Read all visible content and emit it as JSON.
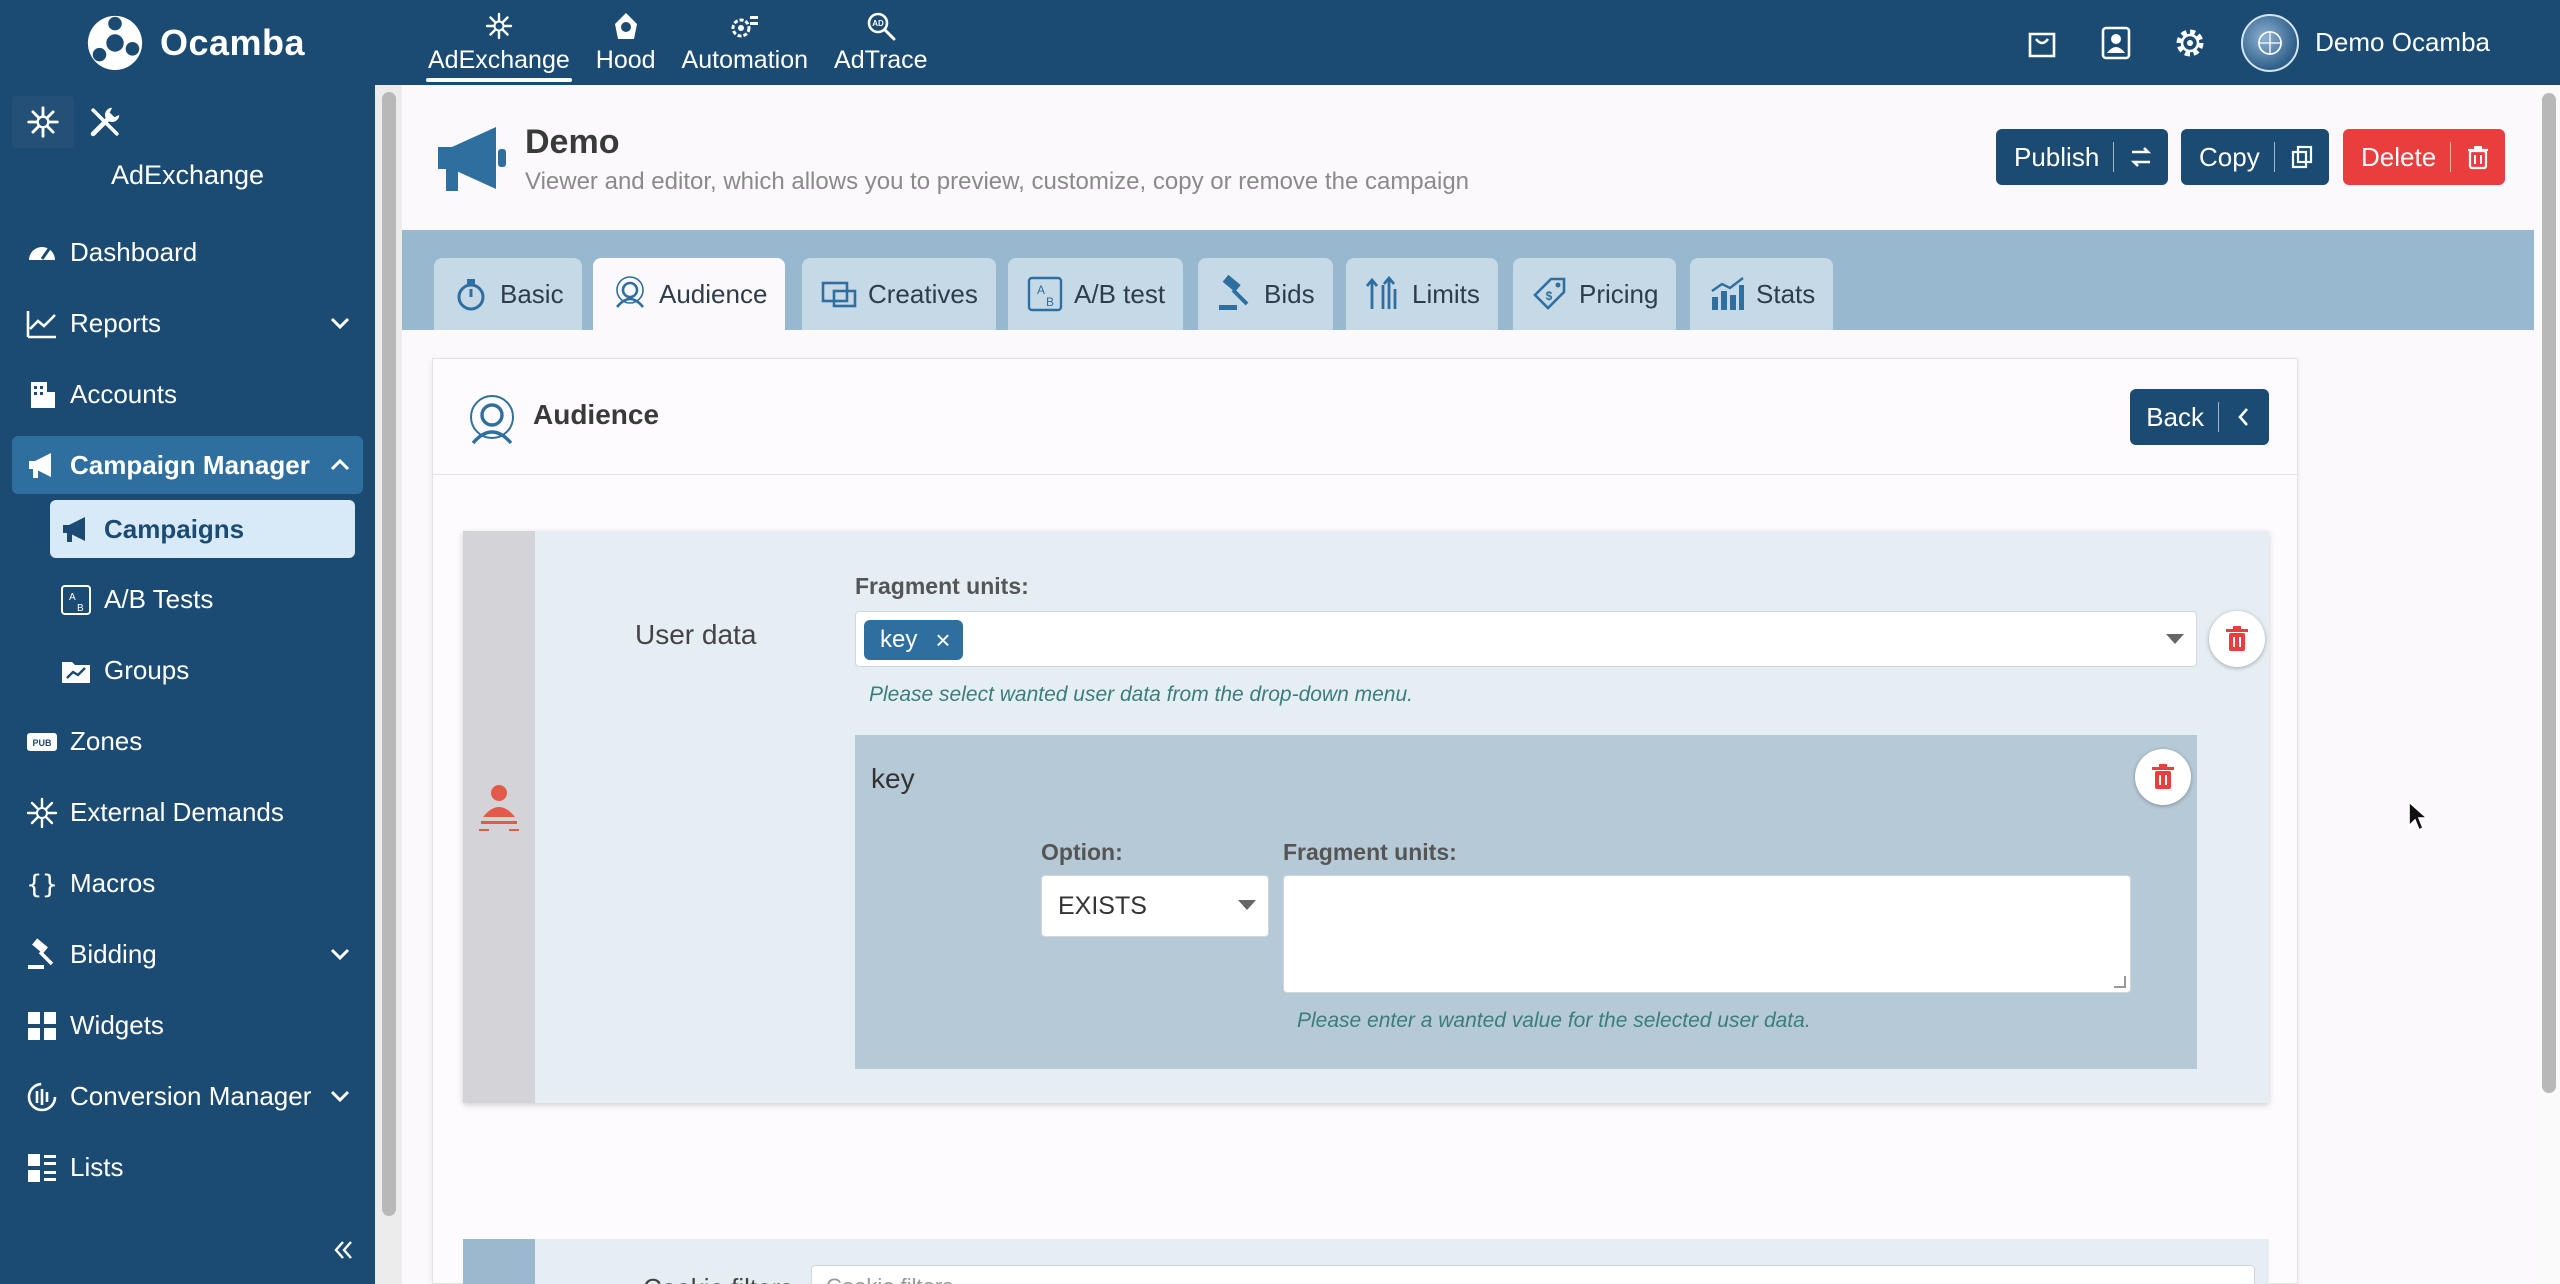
{
  "app": {
    "brand": "Ocamba",
    "topnav": [
      {
        "label": "AdExchange",
        "icon": "adexchange-icon",
        "active": true
      },
      {
        "label": "Hood",
        "icon": "hood-icon"
      },
      {
        "label": "Automation",
        "icon": "automation-icon"
      },
      {
        "label": "AdTrace",
        "icon": "adtrace-icon"
      }
    ],
    "user_name": "Demo Ocamba"
  },
  "sidebar": {
    "section": "AdExchange",
    "items": [
      {
        "label": "Dashboard",
        "icon": "dashboard-icon"
      },
      {
        "label": "Reports",
        "icon": "reports-icon"
      },
      {
        "label": "Accounts",
        "icon": "accounts-icon"
      },
      {
        "label": "Campaign Manager",
        "icon": "megaphone-icon"
      },
      {
        "label": "Campaigns",
        "icon": "megaphone-icon"
      },
      {
        "label": "A/B Tests",
        "icon": "ab-test-icon"
      },
      {
        "label": "Groups",
        "icon": "folder-icon"
      },
      {
        "label": "Zones",
        "icon": "pub-icon"
      },
      {
        "label": "External Demands",
        "icon": "external-demands-icon"
      },
      {
        "label": "Macros",
        "icon": "braces-icon"
      },
      {
        "label": "Bidding",
        "icon": "gavel-icon"
      },
      {
        "label": "Widgets",
        "icon": "widgets-icon"
      },
      {
        "label": "Conversion Manager",
        "icon": "conversion-icon"
      },
      {
        "label": "Lists",
        "icon": "lists-icon"
      }
    ]
  },
  "page": {
    "title": "Demo",
    "subtitle": "Viewer and editor, which allows you to preview, customize, copy or remove the campaign",
    "publish_label": "Publish",
    "copy_label": "Copy",
    "delete_label": "Delete"
  },
  "tabs": [
    {
      "label": "Basic"
    },
    {
      "label": "Audience",
      "active": true
    },
    {
      "label": "Creatives"
    },
    {
      "label": "A/B test"
    },
    {
      "label": "Bids"
    },
    {
      "label": "Limits"
    },
    {
      "label": "Pricing"
    },
    {
      "label": "Stats"
    }
  ],
  "audience": {
    "title": "Audience",
    "back_label": "Back",
    "user_data_label": "User data",
    "fragment_units_label": "Fragment units:",
    "selected_chip": "key",
    "select_hint": "Please select wanted user data from the drop-down menu.",
    "key_block": {
      "title": "key",
      "option_label": "Option:",
      "option_value": "EXISTS",
      "fragment_units_label": "Fragment units:",
      "fragment_value": "",
      "hint": "Please enter a wanted value for the selected user data."
    },
    "next_block": {
      "label": "Cookie filters",
      "placeholder": "Cookie filters"
    }
  },
  "colors": {
    "primary": "#1b4a72",
    "danger": "#ea3e3e",
    "tabs_bg": "#97b8ce",
    "chip": "#2f6fa0"
  }
}
